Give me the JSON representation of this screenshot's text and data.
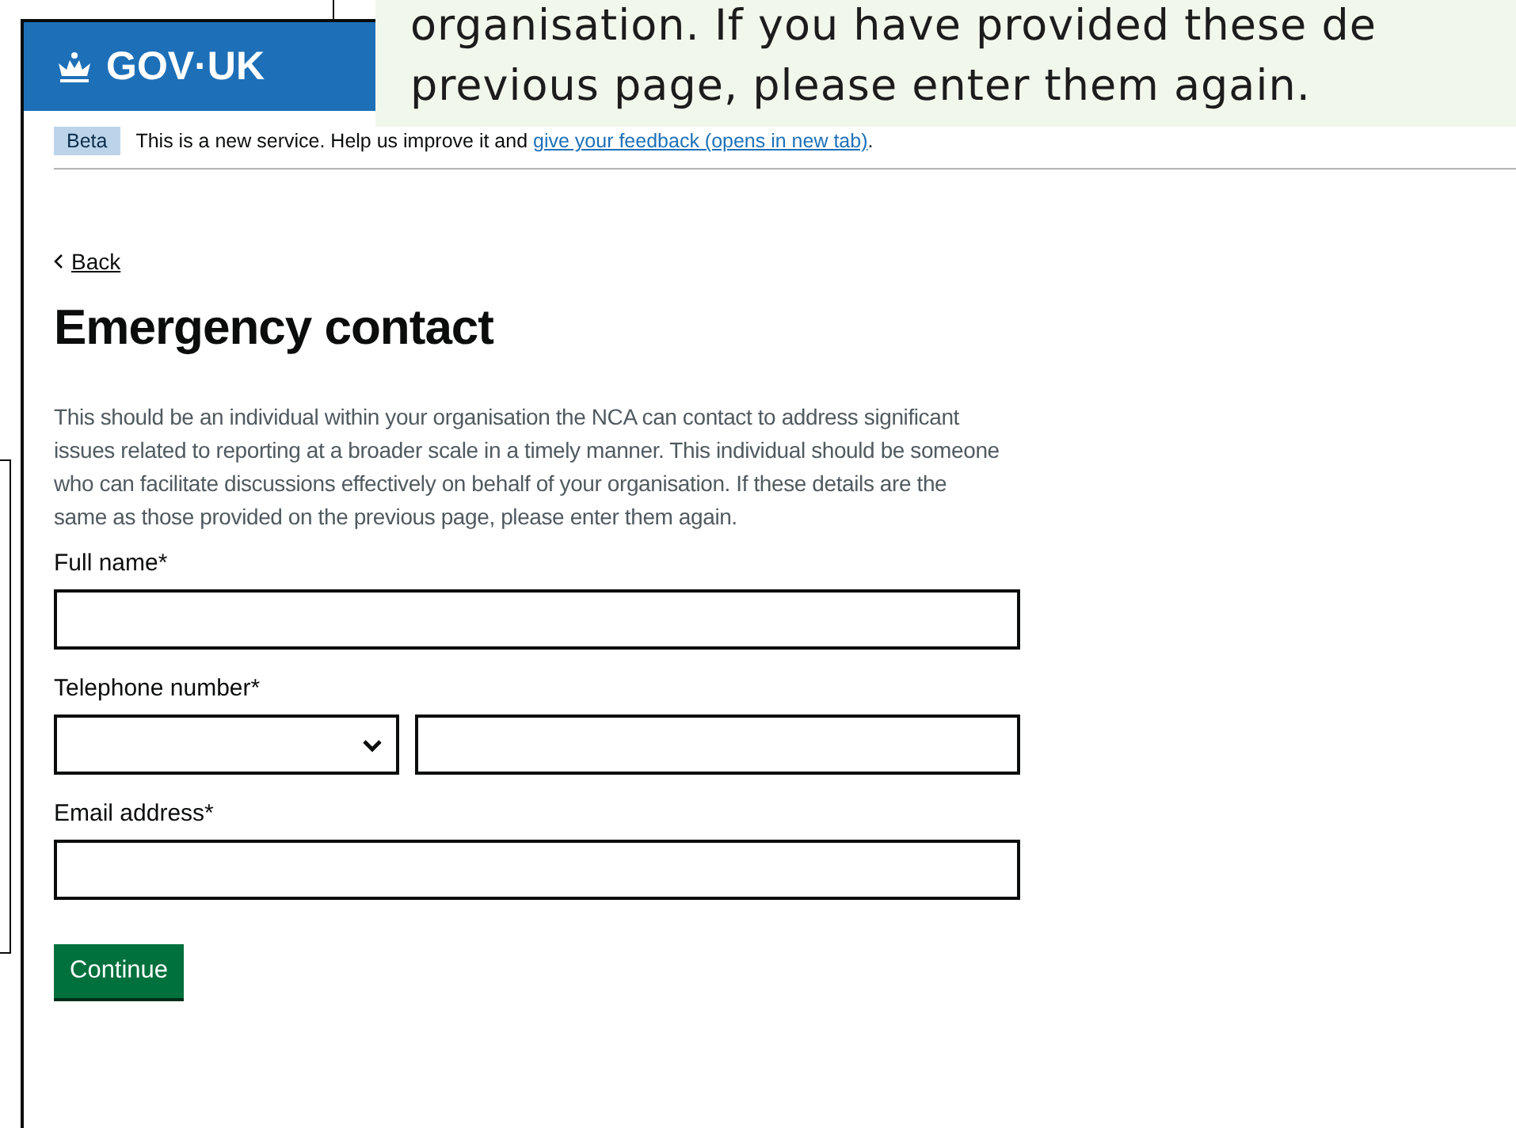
{
  "callout": {
    "lines": [
      "organisation. If you have provided these de",
      "previous page, please enter them again."
    ]
  },
  "header": {
    "logo": "GOV·UK"
  },
  "phase_banner": {
    "tag": "Beta",
    "text": "This is a new service. Help us improve it and",
    "link": "give your feedback (opens in new tab)",
    "after": "."
  },
  "back_link": "Back",
  "heading": "Emergency contact",
  "intro": "This should be an individual within your organisation the NCA can contact to address significant issues related to reporting at a broader scale in a timely manner. This individual should be someone who can facilitate discussions effectively on behalf of your organisation. If these details are the same as those provided on the previous page, please enter them again.",
  "fields": [
    {
      "label": "Full name*",
      "kind": "text"
    },
    {
      "label": "Telephone number*",
      "kind": "phone"
    },
    {
      "label": "Email address*",
      "kind": "text"
    }
  ],
  "button": "Continue"
}
